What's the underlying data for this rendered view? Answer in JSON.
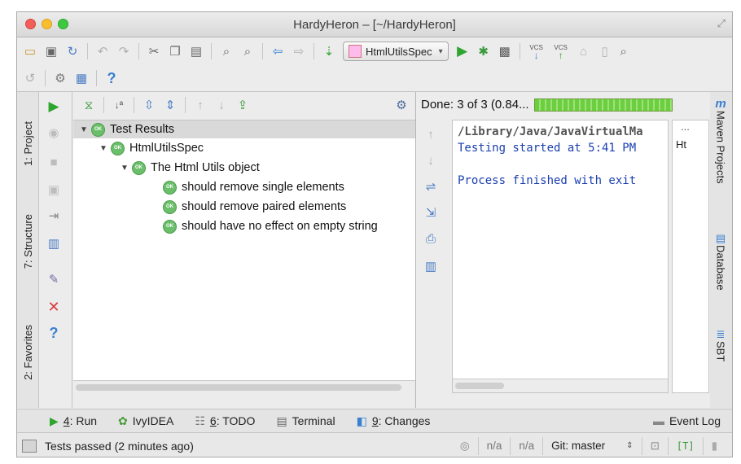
{
  "window": {
    "title": "HardyHeron – [~/HardyHeron]"
  },
  "toolbar": {
    "run_config": "HtmlUtilsSpec",
    "vcs_update": "VCS",
    "vcs_commit": "VCS",
    "help": "?"
  },
  "left_tabs": {
    "project": "1: Project",
    "structure": "7: Structure",
    "favorites": "2: Favorites"
  },
  "right_tabs": {
    "maven": "Maven Projects",
    "database": "Database",
    "sbt": "SBT",
    "maven_glyph": "m"
  },
  "run_panel": {
    "status": "Done: 3 of 3  (0.84...",
    "progress": 1.0,
    "tree": [
      {
        "label": "Test Results",
        "depth": 0,
        "expanded": true,
        "status": "OK"
      },
      {
        "label": "HtmlUtilsSpec",
        "depth": 1,
        "expanded": true,
        "status": "OK"
      },
      {
        "label": "The Html Utils object",
        "depth": 2,
        "expanded": true,
        "status": "OK"
      },
      {
        "label": "should remove single elements",
        "depth": 3,
        "expanded": false,
        "status": "OK"
      },
      {
        "label": "should remove paired elements",
        "depth": 3,
        "expanded": false,
        "status": "OK"
      },
      {
        "label": "should have no effect on empty string",
        "depth": 3,
        "expanded": false,
        "status": "OK"
      }
    ],
    "console": {
      "line1": "/Library/Java/JavaVirtualMa",
      "line2": "Testing started at 5:41 PM",
      "line3": "Process finished with exit"
    },
    "mini_panel": {
      "menu": "...",
      "text": "Ht"
    }
  },
  "bottom_tabs": {
    "run_key": "4",
    "run_label": ": Run",
    "ivy": "IvyIDEA",
    "todo_key": "6",
    "todo_label": ": TODO",
    "terminal": "Terminal",
    "changes_key": "9",
    "changes_label": ": Changes",
    "event_log": "Event Log"
  },
  "statusbar": {
    "message": "Tests passed (2 minutes ago)",
    "pos1": "n/a",
    "pos2": "n/a",
    "git": "Git: master",
    "insert_mode": "[T]"
  },
  "colors": {
    "ok_green": "#6bbf6b",
    "console_blue": "#1a3fb0",
    "run_green": "#2fa52f",
    "help_blue": "#3a7fd1"
  }
}
